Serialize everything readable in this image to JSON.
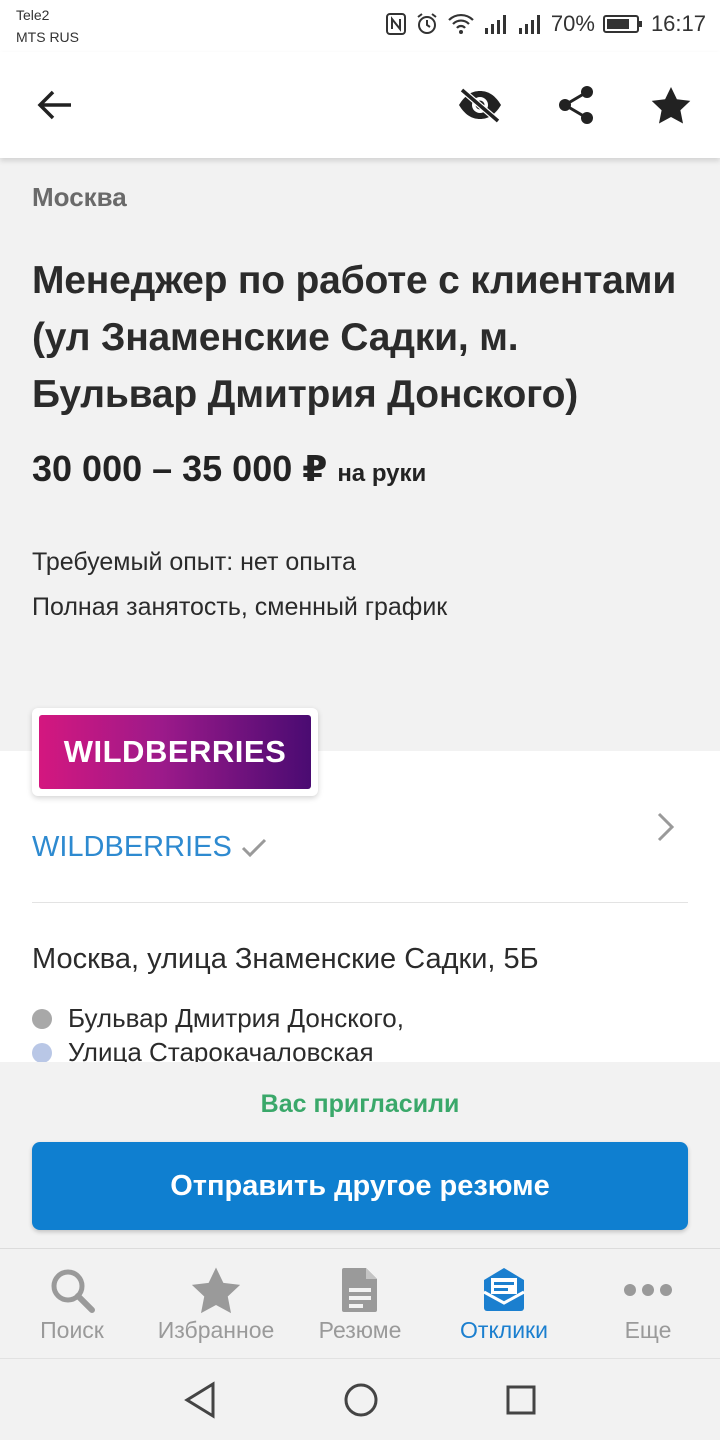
{
  "status_bar": {
    "carrier_1": "Tele2",
    "carrier_2": "MTS RUS",
    "battery": "70%",
    "time": "16:17"
  },
  "app_bar": {
    "icons": [
      "back-arrow-icon",
      "hide-eye-icon",
      "share-icon",
      "star-icon"
    ]
  },
  "vacancy": {
    "city": "Москва",
    "title": "Менеджер по работе с клиентами (ул Знаменские Садки, м. Бульвар Дмитрия Донского)",
    "salary": "30 000 – 35 000 ₽",
    "salary_suffix": "на руки",
    "experience": "Требуемый опыт: нет опыта",
    "schedule": "Полная занятость, сменный график"
  },
  "company": {
    "logo_text": "WILDBERRIES",
    "name": "WILDBERRIES",
    "address": "Москва, улица Знаменские Садки, 5Б",
    "metro": [
      {
        "name": "Бульвар Дмитрия Донского,",
        "color": "#a8a8a8"
      },
      {
        "name": "Улица Старокачаловская",
        "color": "#b9c7e6"
      }
    ]
  },
  "action": {
    "status": "Вас пригласили",
    "button": "Отправить другое резюме",
    "status_color": "#3aa86a",
    "button_color": "#0f7fd0"
  },
  "tabs": [
    {
      "label": "Поиск",
      "icon": "search-icon"
    },
    {
      "label": "Избранное",
      "icon": "star-icon"
    },
    {
      "label": "Резюме",
      "icon": "document-icon"
    },
    {
      "label": "Отклики",
      "icon": "inbox-icon",
      "active": true
    },
    {
      "label": "Еще",
      "icon": "more-icon"
    }
  ],
  "colors": {
    "accent": "#1b7fcf",
    "link": "#2e8ad0"
  }
}
